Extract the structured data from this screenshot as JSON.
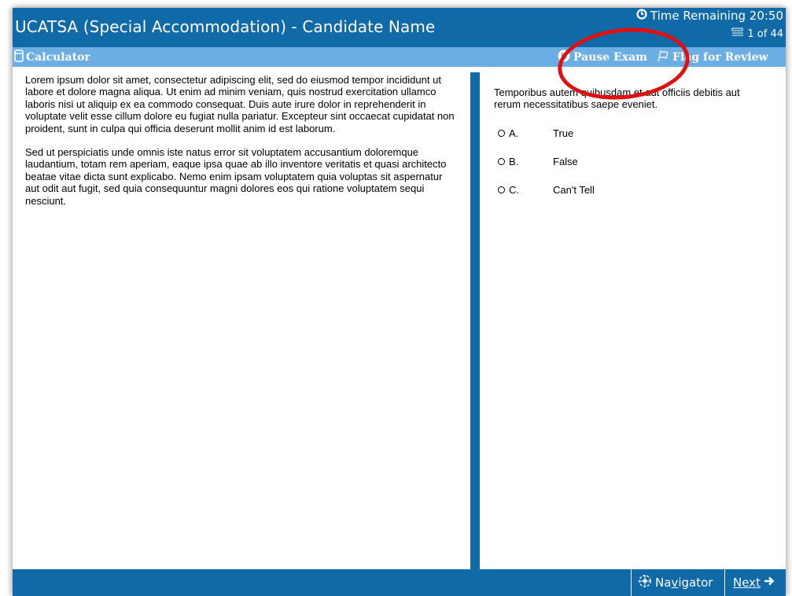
{
  "window": {
    "title": "UCATSA (Special Accommodation) - Candidate Name",
    "time_remaining": "Time Remaining 20:50",
    "question_counter": "1 of 44"
  },
  "toolbar": {
    "calculator_label": "Calculator",
    "pause_label": "Pause Exam",
    "flag_label": "Flag for Review"
  },
  "passage": {
    "paragraphs": [
      "Lorem ipsum dolor sit amet, consectetur adipiscing elit, sed do eiusmod tempor incididunt ut labore et dolore magna aliqua. Ut enim ad minim veniam, quis nostrud exercitation ullamco laboris nisi ut aliquip ex ea commodo consequat. Duis aute irure dolor in reprehenderit in voluptate velit esse cillum dolore eu fugiat nulla pariatur. Excepteur sint occaecat cupidatat non proident, sunt in culpa qui officia deserunt mollit anim id est laborum.",
      "Sed ut perspiciatis unde omnis iste natus error sit voluptatem accusantium doloremque laudantium, totam rem aperiam, eaque ipsa quae ab illo inventore veritatis et quasi architecto beatae vitae dicta sunt explicabo. Nemo enim ipsam voluptatem quia voluptas sit aspernatur aut odit aut fugit, sed quia consequuntur magni dolores eos qui ratione voluptatem sequi nesciunt."
    ]
  },
  "question": {
    "text": "Temporibus autem quibusdam et aut officiis debitis aut rerum necessitatibus saepe eveniet.",
    "options": [
      {
        "letter": "A.",
        "label": "True"
      },
      {
        "letter": "B.",
        "label": "False"
      },
      {
        "letter": "C.",
        "label": "Can't Tell"
      }
    ]
  },
  "footer": {
    "navigator_prefix": "Na",
    "navigator_underlined": "v",
    "navigator_suffix": "igator",
    "next_label": "Next"
  },
  "icons": {
    "clock": "clock-icon",
    "counter": "stack-icon",
    "calculator": "calculator-icon",
    "pause": "pause-icon",
    "flag": "flag-icon",
    "navigator": "navigator-icon",
    "next": "arrow-right-icon"
  },
  "colors": {
    "title_bar": "#0f6aa7",
    "toolbar": "#6aaee3",
    "annotation": "#e01010"
  }
}
